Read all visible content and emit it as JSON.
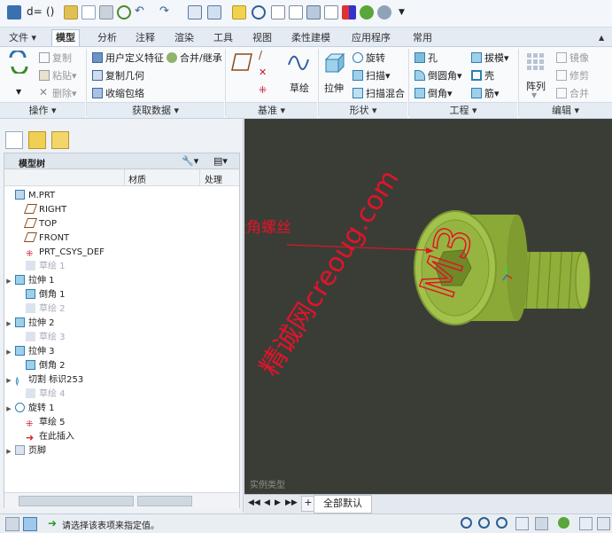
{
  "ribbon_tabs": [
    "文件",
    "模型",
    "分析",
    "注释",
    "渲染",
    "工具",
    "视图",
    "柔性建模",
    "应用程序",
    "常用"
  ],
  "ops": {
    "copy": "复制",
    "paste": "粘贴",
    "delete": "删除",
    "group": "操作"
  },
  "getdata": {
    "udf": "用户定义特征",
    "merge": "合并/继承",
    "copygeom": "复制几何",
    "shrink": "收缩包络",
    "group": "获取数据"
  },
  "datum": {
    "sketch": "草绘",
    "group": "基准"
  },
  "shapes": {
    "extrude": "拉伸",
    "revolve": "旋转",
    "sweep": "扫描",
    "blend": "扫描混合",
    "group": "形状"
  },
  "eng": {
    "hole": "孔",
    "round": "倒圆角",
    "chamfer": "倒角",
    "draft": "拔模",
    "shell": "壳",
    "rib": "筋",
    "group": "工程"
  },
  "edit": {
    "pattern": "阵列",
    "mirror": "镜像",
    "trim": "修剪",
    "merge": "合并",
    "group": "编辑"
  },
  "tree": {
    "title": "模型树",
    "col_material": "材质",
    "col_handle": "处理",
    "items": [
      {
        "label": "M.PRT"
      },
      {
        "label": "RIGHT"
      },
      {
        "label": "TOP"
      },
      {
        "label": "FRONT"
      },
      {
        "label": "PRT_CSYS_DEF"
      },
      {
        "label": "草绘 1"
      },
      {
        "label": "拉伸 1"
      },
      {
        "label": "倒角 1"
      },
      {
        "label": "草绘 2"
      },
      {
        "label": "拉伸 2"
      },
      {
        "label": "草绘 3"
      },
      {
        "label": "拉伸 3"
      },
      {
        "label": "倒角 2"
      },
      {
        "label": "切割 标识253"
      },
      {
        "label": "草绘 4"
      },
      {
        "label": "旋转 1"
      },
      {
        "label": "草绘 5"
      },
      {
        "label": "在此插入"
      },
      {
        "label": "页脚"
      }
    ]
  },
  "viewport": {
    "annotation": "标注内六角螺丝",
    "watermark_site": "精诚网creoug.com",
    "model_label": "M3",
    "tag": "实例类型"
  },
  "view_tabs": {
    "current": "全部默认"
  },
  "status": {
    "message": "请选择该表项来指定值。"
  },
  "colors": {
    "model": "#8fae3a",
    "viewport_bg": "#3a3d36",
    "annotation": "#e0142a"
  }
}
